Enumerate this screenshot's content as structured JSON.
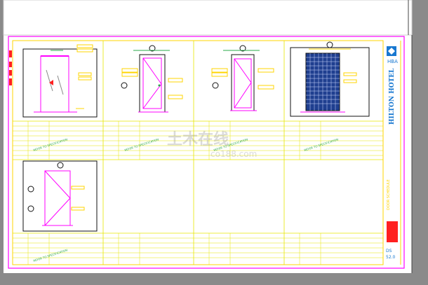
{
  "colors": {
    "background": "#8a8a8a",
    "paper": "#ffffff",
    "frame": "#ff00ff",
    "border": "#ffd400",
    "line": "#e6e600",
    "dim": "#2aa84a",
    "door": "#ff00ff",
    "glass": "#1f3f8f",
    "title": "#1878d0",
    "stamp": "#ff2020",
    "text": "#222222"
  },
  "title_block": {
    "logo": "HBA",
    "project": "HILTON HOTEL",
    "drawing_title": "DOOR SCHEDULE",
    "sheet_no": "52.0",
    "sheet_prefix": "DS"
  },
  "notes": {
    "note_text": "REFER TO SPECIFICATION"
  },
  "watermark": {
    "brand": "土木在线",
    "url": "co188.com"
  },
  "elevations": [
    {
      "id": "elevation-1",
      "type": "sliding glass door"
    },
    {
      "id": "elevation-2",
      "type": "swing door with glass panel"
    },
    {
      "id": "elevation-3",
      "type": "swing door with glass panel"
    },
    {
      "id": "elevation-4",
      "type": "grille door"
    },
    {
      "id": "elevation-5",
      "type": "swing door"
    }
  ]
}
